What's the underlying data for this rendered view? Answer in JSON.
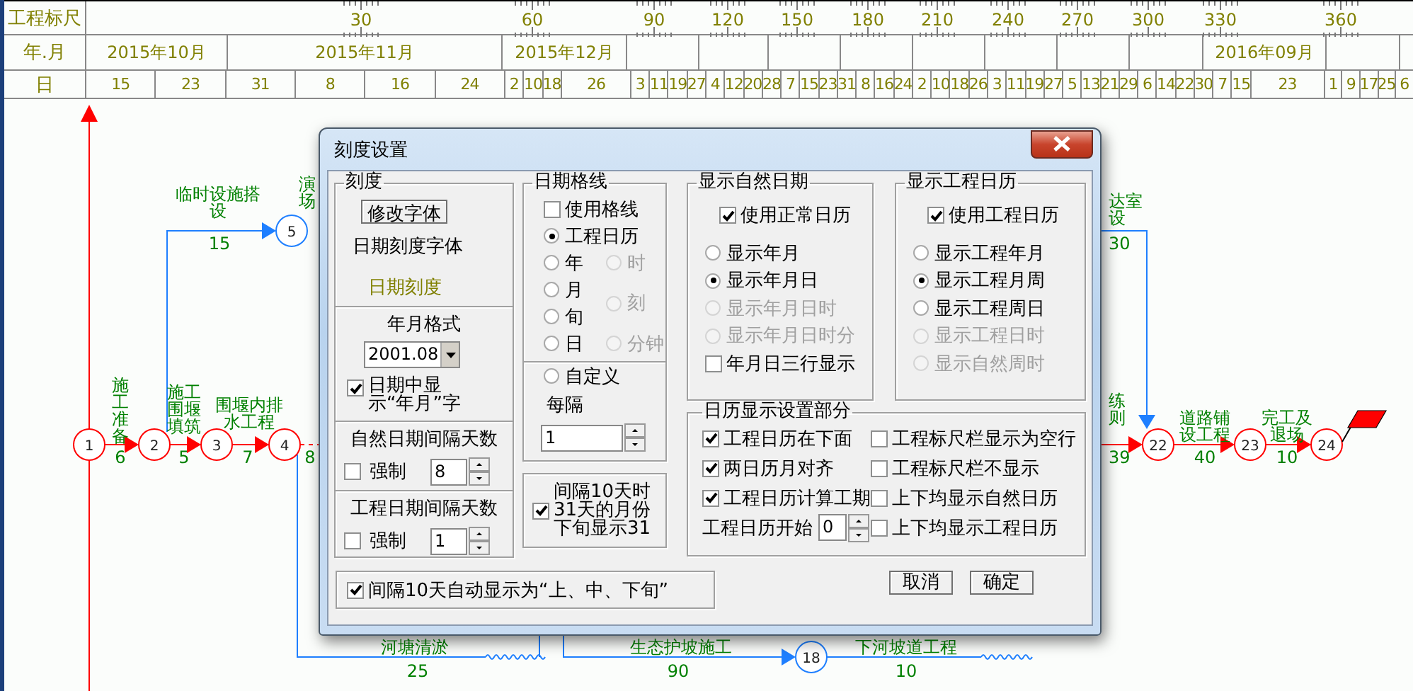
{
  "ruler": {
    "label": "工程标尺",
    "ticks": [
      "30",
      "60",
      "90",
      "120",
      "150",
      "180",
      "210",
      "240",
      "270",
      "300",
      "330",
      "360"
    ]
  },
  "months": {
    "label": "年.月",
    "cells": [
      "2015年10月",
      "2015年11月",
      "2015年12月",
      "2016年09月"
    ]
  },
  "days": {
    "label": "日",
    "cells": [
      "15",
      "23",
      "31",
      "8",
      "16",
      "24",
      "2",
      "10",
      "18",
      "26",
      "3",
      "11",
      "19",
      "27",
      "4",
      "12",
      "20",
      "28",
      "7",
      "15",
      "23",
      "31",
      "8",
      "16",
      "24",
      "2",
      "10",
      "18",
      "26",
      "3",
      "11",
      "19",
      "27",
      "5",
      "13",
      "21",
      "29",
      "6",
      "14",
      "22",
      "30",
      "7",
      "15",
      "23",
      "1",
      "9",
      "17",
      "25",
      "6"
    ]
  },
  "network": {
    "nodes": [
      {
        "label": "1",
        "kind": "critical"
      },
      {
        "label": "2",
        "kind": "critical"
      },
      {
        "label": "3",
        "kind": "critical"
      },
      {
        "label": "4",
        "kind": "critical"
      },
      {
        "label": "5",
        "kind": "normal"
      },
      {
        "label": "18",
        "kind": "normal"
      },
      {
        "label": "22",
        "kind": "critical"
      },
      {
        "label": "23",
        "kind": "critical"
      },
      {
        "label": "24",
        "kind": "critical"
      }
    ],
    "labels": [
      {
        "lines": [
          "临时设施搭",
          "设"
        ],
        "duration": "15"
      },
      {
        "lines": [
          "演",
          "场"
        ]
      },
      {
        "lines": [
          "施",
          "工",
          "准",
          "备"
        ],
        "duration": "6"
      },
      {
        "lines": [
          "施工",
          "围堰",
          "填筑"
        ],
        "duration": "5"
      },
      {
        "lines": [
          "围堰内排",
          "水工程"
        ],
        "duration": "7"
      },
      {
        "duration": "8"
      },
      {
        "lines": [
          "达室",
          "设"
        ]
      },
      {
        "duration": "30"
      },
      {
        "lines": [
          "练",
          "则"
        ]
      },
      {
        "duration": "39"
      },
      {
        "lines": [
          "道路铺",
          "设工程"
        ],
        "duration": "40"
      },
      {
        "lines": [
          "完工及",
          "退场"
        ],
        "duration": "10"
      },
      {
        "lines": [
          "河塘清淤"
        ],
        "duration": "25"
      },
      {
        "lines": [
          "生态护坡施工"
        ],
        "duration": "90"
      },
      {
        "lines": [
          "下河坡道工程"
        ],
        "duration": "10"
      }
    ]
  },
  "dialog": {
    "title": "刻度设置",
    "scale": {
      "title": "刻度",
      "font_button": "修改字体",
      "font_label": "日期刻度字体",
      "sample": "日期刻度",
      "format_label": "年月格式",
      "format_value": "2001.08",
      "show_yearmonth": {
        "label": "日期中显示“年月”字",
        "checked": true
      }
    },
    "natural_interval": {
      "title": "自然日期间隔天数",
      "force": {
        "label": "强制",
        "checked": false
      },
      "value": "8"
    },
    "project_interval": {
      "title": "工程日期间隔天数",
      "force": {
        "label": "强制",
        "checked": false
      },
      "value": "1"
    },
    "gridlines": {
      "title": "日期格线",
      "use": {
        "label": "使用格线",
        "checked": false
      },
      "options": [
        {
          "label": "工程日历",
          "selected": true,
          "disabled": false
        },
        {
          "label": "年",
          "selected": false,
          "disabled": false
        },
        {
          "label": "月",
          "selected": false,
          "disabled": false
        },
        {
          "label": "旬",
          "selected": false,
          "disabled": false
        },
        {
          "label": "日",
          "selected": false,
          "disabled": false
        },
        {
          "label": "时",
          "selected": false,
          "disabled": true
        },
        {
          "label": "刻",
          "selected": false,
          "disabled": true
        },
        {
          "label": "分钟",
          "selected": false,
          "disabled": true
        }
      ],
      "custom": {
        "label": "自定义",
        "selected": false
      },
      "every_label": "每隔",
      "every_value": "1"
    },
    "day31": {
      "label": "间隔10天时31天的月份下旬显示31",
      "checked": true
    },
    "natural_dates": {
      "title": "显示自然日期",
      "use": {
        "label": "使用正常日历",
        "checked": true
      },
      "options": [
        {
          "label": "显示年月",
          "selected": false,
          "disabled": false
        },
        {
          "label": "显示年月日",
          "selected": true,
          "disabled": false
        },
        {
          "label": "显示年月日时",
          "selected": false,
          "disabled": true
        },
        {
          "label": "显示年月日时分",
          "selected": false,
          "disabled": true
        }
      ],
      "three_rows": {
        "label": "年月日三行显示",
        "checked": false
      }
    },
    "project_calendar": {
      "title": "显示工程日历",
      "use": {
        "label": "使用工程日历",
        "checked": true
      },
      "options": [
        {
          "label": "显示工程年月",
          "selected": false,
          "disabled": false
        },
        {
          "label": "显示工程月周",
          "selected": true,
          "disabled": false
        },
        {
          "label": "显示工程周日",
          "selected": false,
          "disabled": false
        },
        {
          "label": "显示工程日时",
          "selected": false,
          "disabled": true
        },
        {
          "label": "显示自然周时",
          "selected": false,
          "disabled": true
        }
      ]
    },
    "calendar_settings": {
      "title": "日历显示设置部分",
      "left": [
        {
          "label": "工程日历在下面",
          "checked": true
        },
        {
          "label": "两日历月对齐",
          "checked": true
        },
        {
          "label": "工程日历计算工期",
          "checked": true
        }
      ],
      "start": {
        "label": "工程日历开始",
        "value": "0"
      },
      "right": [
        {
          "label": "工程标尺栏显示为空行",
          "checked": false
        },
        {
          "label": "工程标尺栏不显示",
          "checked": false
        },
        {
          "label": "上下均显示自然日历",
          "checked": false
        },
        {
          "label": "上下均显示工程日历",
          "checked": false
        }
      ]
    },
    "auto_xun": {
      "label": "间隔10天自动显示为“上、中、下旬”",
      "checked": true
    },
    "buttons": [
      "取消",
      "确定"
    ]
  }
}
